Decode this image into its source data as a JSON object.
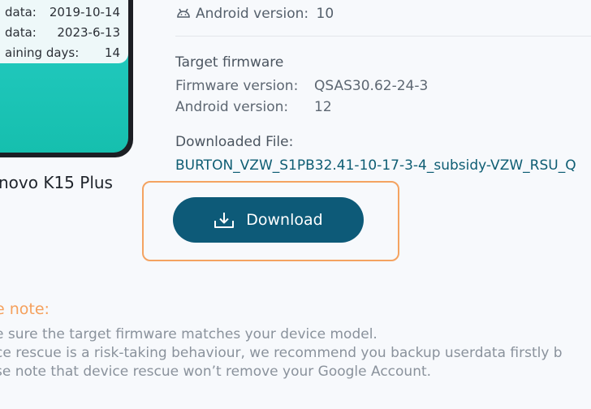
{
  "device_card": {
    "rows": [
      {
        "key": "data:",
        "value": "2019-10-14"
      },
      {
        "key": "data:",
        "value": "2023-6-13"
      },
      {
        "key": "aining days:",
        "value": "14"
      }
    ],
    "model_name": "novo K15 Plus"
  },
  "current": {
    "android_label": "Android version:",
    "android_value": "10",
    "android_icon": "android-icon"
  },
  "target": {
    "title": "Target firmware",
    "firmware_label": "Firmware version:",
    "firmware_value": "QSAS30.62-24-3",
    "android_label": "Android version:",
    "android_value": "12"
  },
  "download": {
    "file_label": "Downloaded File:",
    "file_name": "BURTON_VZW_S1PB32.41-10-17-3-4_subsidy-VZW_RSU_Q",
    "button_label": "Download",
    "button_icon": "download-icon"
  },
  "notes": {
    "title": "e note:",
    "lines": [
      "e sure the target firmware matches your device model.",
      "ce rescue is a risk-taking behaviour, we recommend you backup userdata firstly b",
      "se note that device rescue won’t remove your Google Account."
    ]
  },
  "colors": {
    "accent": "#0d5a78",
    "highlight": "#f4a361",
    "note_title": "#f5a05c",
    "phone_screen": "#1fc7bb"
  }
}
